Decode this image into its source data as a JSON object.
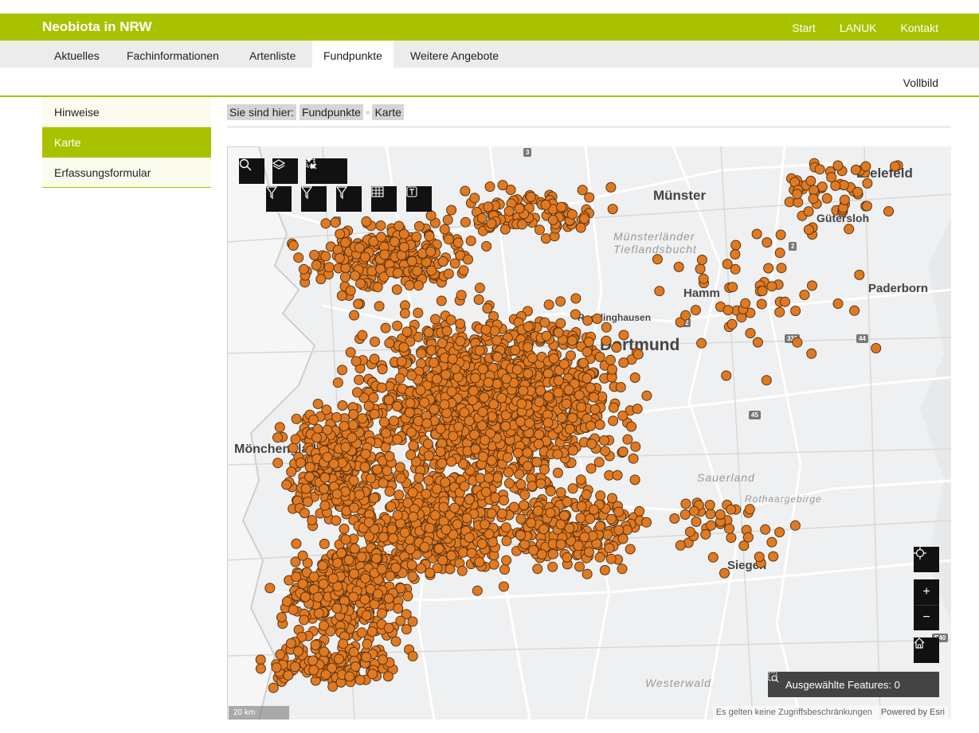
{
  "header": {
    "brand": "Neobiota in NRW",
    "links": [
      "Start",
      "LANUK",
      "Kontakt"
    ]
  },
  "nav": {
    "tabs": [
      "Aktuelles",
      "Fachinformationen",
      "Artenliste",
      "Fundpunkte",
      "Weitere Angebote"
    ],
    "active": "Fundpunkte",
    "vollbild": "Vollbild"
  },
  "sidebar": {
    "items": [
      "Hinweise",
      "Karte",
      "Erfassungsformular"
    ],
    "active": "Karte"
  },
  "breadcrumb": {
    "prefix": "Sie sind hier:",
    "items": [
      "Fundpunkte",
      "Karte"
    ],
    "separator": "»"
  },
  "map": {
    "place_labels": [
      "Bielefeld",
      "Münster",
      "Gütersloh",
      "Paderborn",
      "Hamm",
      "Dortmund",
      "Mönchengladbach",
      "Siegen",
      "Recklinghausen"
    ],
    "terrain_labels": [
      "Münsterländer Tieflandsbucht",
      "Sauerland",
      "Rothaargebirge",
      "Westerwald"
    ],
    "road_shields": [
      "3",
      "2",
      "331",
      "44",
      "45",
      "3",
      "2",
      "E40"
    ],
    "scale": "20 km",
    "attribution": "Es gelten keine Zugriffsbeschränkungen",
    "powered_by": "Powered by Esri",
    "selected_features_label": "Ausgewählte Features: 0",
    "zoom_in": "+",
    "zoom_out": "−",
    "point_color": "#e07a22",
    "point_stroke": "#5a3210"
  },
  "colors": {
    "brand_green": "#a9c200",
    "nav_gray": "#ececec"
  }
}
